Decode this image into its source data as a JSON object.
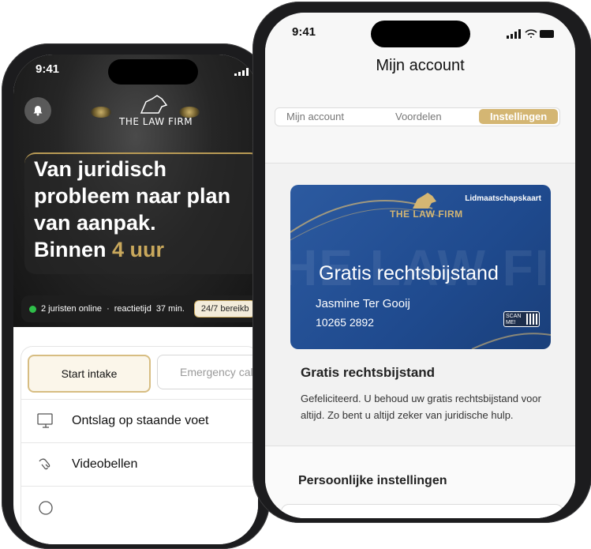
{
  "left_phone": {
    "time": "9:41",
    "logo": "THE LAW FIRM",
    "headline_line1": "Van juridisch",
    "headline_line2": "probleem naar plan",
    "headline_line3": "van aanpak.",
    "headline_prefix": "Binnen ",
    "headline_highlight": "4 uur",
    "stats_online": "2 juristen online",
    "stats_separator": "·",
    "stats_reaction": "reactietijd",
    "stats_minutes": "37 min.",
    "stats_pill": "24/7 bereikb",
    "start_intake": "Start intake",
    "emergency": "Emergency cal",
    "rows": [
      {
        "label": "Ontslag op staande voet",
        "icon": "monitor-icon"
      },
      {
        "label": "Videobellen",
        "icon": "handshake-icon"
      },
      {
        "label": "",
        "icon": "globe-icon"
      }
    ],
    "chevron": "›"
  },
  "right_phone": {
    "time": "9:41",
    "title": "Mijn account",
    "tabs": [
      {
        "label": "Mijn account",
        "active": false
      },
      {
        "label": "Voordelen",
        "active": false
      },
      {
        "label": "Instellingen",
        "active": true
      }
    ],
    "card": {
      "type_label": "Lidmaatschapskaart",
      "logo": "THE LAW FIRM",
      "watermark": "HE LAW FI",
      "headline": "Gratis rechtsbijstand",
      "member_name": "Jasmine Ter Gooij",
      "member_number": "10265 2892",
      "scan_label": "SCAN ME!"
    },
    "section_title": "Gratis rechtsbijstand",
    "section_body": "Gefeliciteerd. U behoud uw gratis rechtsbijstand voor altijd. Zo bent u altijd zeker van juridische hulp.",
    "personal_settings": "Persoonlijke instellingen"
  },
  "colors": {
    "accent_gold": "#c9a85c",
    "card_blue": "#2c5aa0",
    "online_green": "#2fbf4a"
  }
}
